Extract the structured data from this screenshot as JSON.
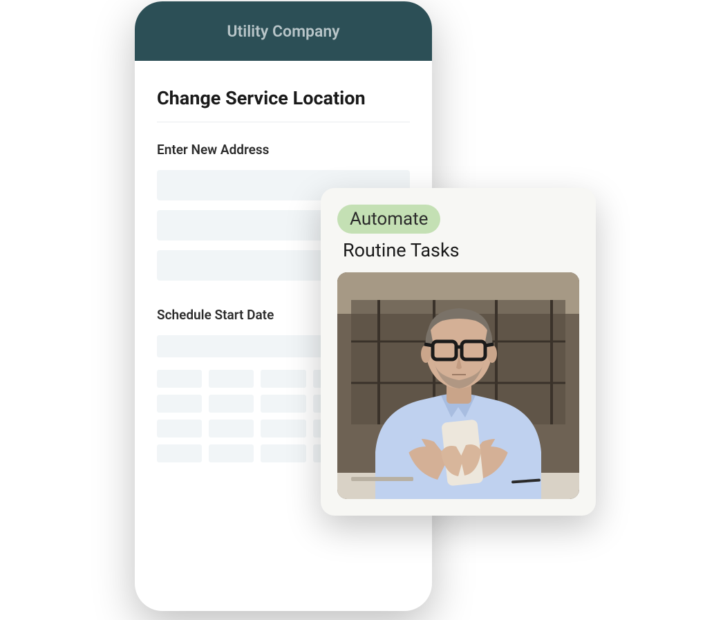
{
  "phone": {
    "header_title": "Utility Company",
    "page_title": "Change Service Location",
    "address_section_label": "Enter New Address",
    "schedule_section_label": "Schedule Start Date"
  },
  "overlay": {
    "badge_text": "Automate",
    "subtext": "Routine Tasks"
  }
}
